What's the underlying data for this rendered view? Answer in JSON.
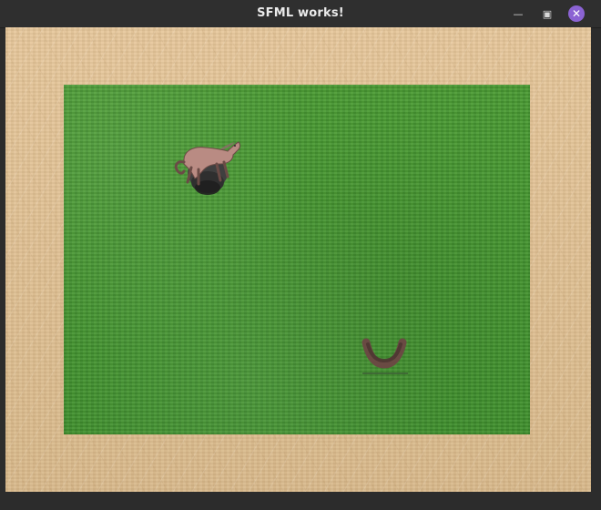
{
  "window": {
    "title": "SFML works!",
    "controls": {
      "minimize_icon": "minimize-icon",
      "restore_icon": "restore-icon",
      "close_icon": "close-icon"
    },
    "accent": "#8b63d3"
  },
  "scene": {
    "background": "sand",
    "field": "grass",
    "sprites": [
      {
        "name": "horse",
        "icon": "horse-sprite"
      },
      {
        "name": "burrow",
        "icon": "burrow-sprite"
      }
    ]
  }
}
